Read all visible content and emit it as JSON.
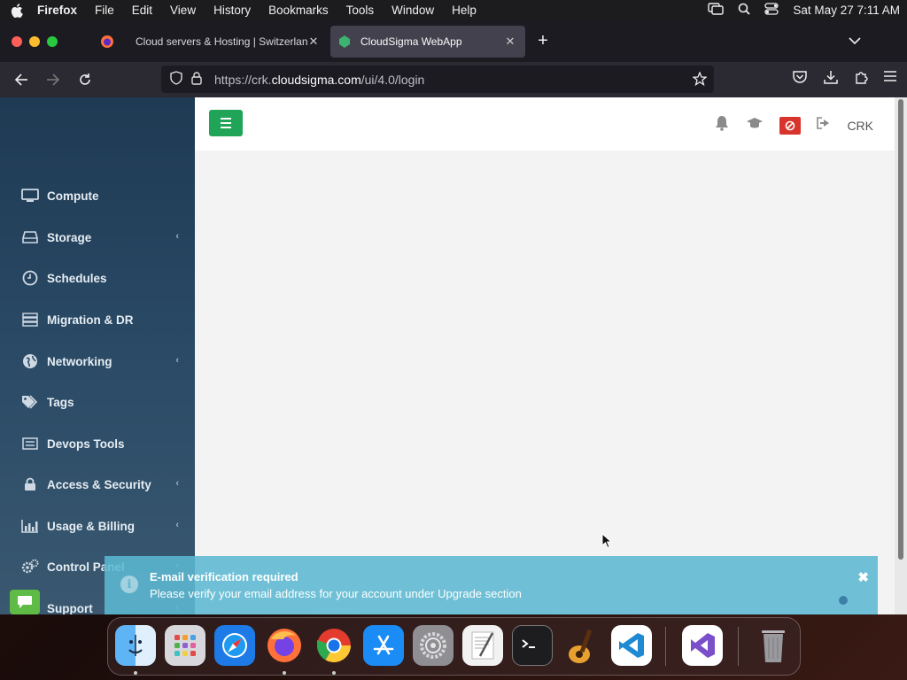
{
  "menubar": {
    "app_name": "Firefox",
    "items": [
      "File",
      "Edit",
      "View",
      "History",
      "Bookmarks",
      "Tools",
      "Window",
      "Help"
    ],
    "clock": "Sat May 27  7:11 AM"
  },
  "browser": {
    "tabs": [
      {
        "title": "Cloud servers & Hosting | Switzerlan"
      },
      {
        "title": "CloudSigma WebApp"
      }
    ],
    "url_prefix": "https://crk.",
    "url_host": "cloudsigma.com",
    "url_path": "/ui/4.0/login"
  },
  "app": {
    "user": "CRK",
    "sidebar": [
      {
        "label": "Compute",
        "icon": "monitor-icon",
        "has_submenu": false
      },
      {
        "label": "Storage",
        "icon": "hard-drive-icon",
        "has_submenu": true
      },
      {
        "label": "Schedules",
        "icon": "clock-icon",
        "has_submenu": false
      },
      {
        "label": "Migration & DR",
        "icon": "server-icon",
        "has_submenu": false
      },
      {
        "label": "Networking",
        "icon": "globe-icon",
        "has_submenu": true
      },
      {
        "label": "Tags",
        "icon": "tags-icon",
        "has_submenu": false
      },
      {
        "label": "Devops Tools",
        "icon": "list-icon",
        "has_submenu": false
      },
      {
        "label": "Access & Security",
        "icon": "lock-icon",
        "has_submenu": true
      },
      {
        "label": "Usage & Billing",
        "icon": "bar-chart-icon",
        "has_submenu": true
      },
      {
        "label": "Control Panel",
        "icon": "gears-icon",
        "has_submenu": true
      },
      {
        "label": "Support",
        "icon": "support-icon",
        "has_submenu": true
      }
    ],
    "toast": {
      "title": "E-mail verification required",
      "message": "Please verify your email address for your account under Upgrade section"
    }
  },
  "dock": {
    "apps": [
      "Finder",
      "Launchpad",
      "Safari",
      "Firefox",
      "Google Chrome",
      "App Store",
      "System Preferences",
      "TextEdit",
      "Terminal",
      "GarageBand",
      "Visual Studio Code",
      "Visual Studio",
      "Trash"
    ]
  }
}
